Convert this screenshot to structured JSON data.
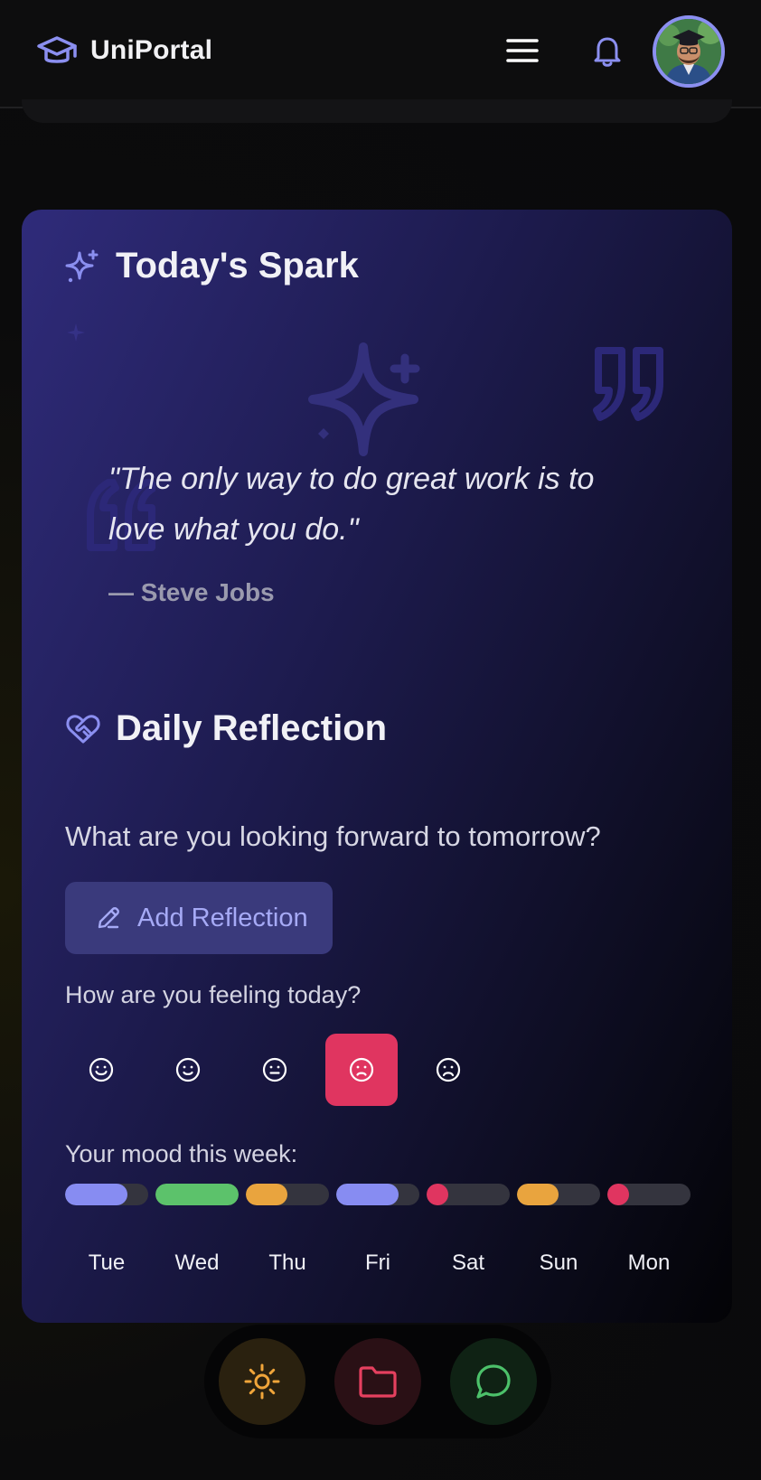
{
  "header": {
    "brand": "UniPortal",
    "brand_icon": "graduation-cap-icon",
    "menu_icon": "hamburger-menu-icon",
    "notification_icon": "bell-icon",
    "accent": "#8b8ff0"
  },
  "spark": {
    "title": "Today's Spark",
    "quote": "\"The only way to do great work is to love what you do.\"",
    "author": "— Steve Jobs"
  },
  "reflection": {
    "title": "Daily Reflection",
    "question": "What are you looking forward to tomorrow?",
    "add_button": "Add Reflection",
    "feeling_prompt": "How are you feeling today?",
    "moods": [
      {
        "name": "very-happy",
        "selected": false
      },
      {
        "name": "happy",
        "selected": false
      },
      {
        "name": "neutral",
        "selected": false
      },
      {
        "name": "sad",
        "selected": true
      },
      {
        "name": "very-sad",
        "selected": false
      }
    ],
    "selected_color": "#e03560"
  },
  "week_mood": {
    "label": "Your mood this week:",
    "days": [
      {
        "day": "Tue",
        "level": 0.75,
        "color": "#878cf2"
      },
      {
        "day": "Wed",
        "level": 1.0,
        "color": "#5cc26b"
      },
      {
        "day": "Thu",
        "level": 0.5,
        "color": "#e9a43e"
      },
      {
        "day": "Fri",
        "level": 0.75,
        "color": "#878cf2"
      },
      {
        "day": "Sat",
        "level": 0.25,
        "color": "#e03560"
      },
      {
        "day": "Sun",
        "level": 0.5,
        "color": "#e9a43e"
      },
      {
        "day": "Mon",
        "level": 0.25,
        "color": "#e03560"
      }
    ]
  },
  "dock": {
    "items": [
      {
        "icon": "sun-icon",
        "color": "#f0a53a"
      },
      {
        "icon": "folder-icon",
        "color": "#e5405f"
      },
      {
        "icon": "chat-bubble-icon",
        "color": "#4cc16a"
      }
    ]
  }
}
